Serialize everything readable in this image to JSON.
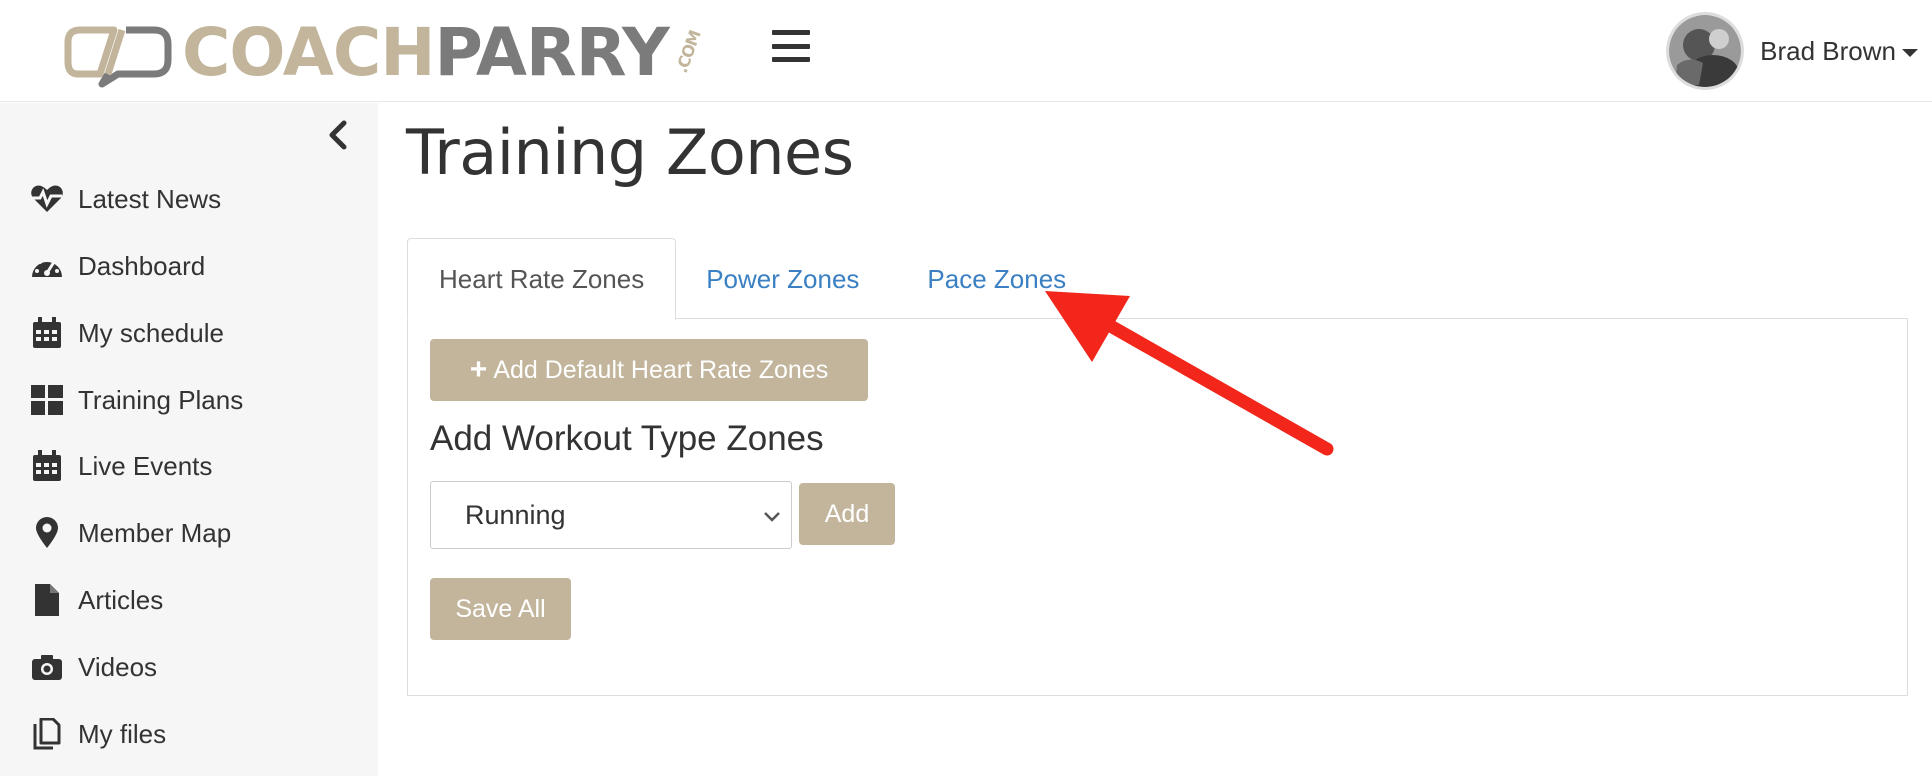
{
  "header": {
    "logo": {
      "coach": "COACH",
      "parry": "PARRY",
      "com": ".COM"
    },
    "menu_icon": "hamburger-icon",
    "user": {
      "name": "Brad Brown",
      "avatar_icon": "avatar"
    }
  },
  "sidebar": {
    "collapse_icon": "chevron-left-icon",
    "items": [
      {
        "label": "Latest News",
        "icon": "heartbeat-icon"
      },
      {
        "label": "Dashboard",
        "icon": "tachometer-icon"
      },
      {
        "label": "My schedule",
        "icon": "calendar-icon"
      },
      {
        "label": "Training Plans",
        "icon": "grid-icon"
      },
      {
        "label": "Live Events",
        "icon": "calendar-icon"
      },
      {
        "label": "Member Map",
        "icon": "map-marker-icon"
      },
      {
        "label": "Articles",
        "icon": "file-icon"
      },
      {
        "label": "Videos",
        "icon": "camera-icon"
      },
      {
        "label": "My files",
        "icon": "copy-icon"
      }
    ]
  },
  "main": {
    "title": "Training Zones",
    "tabs": [
      {
        "label": "Heart Rate Zones",
        "active": true
      },
      {
        "label": "Power Zones",
        "active": false
      },
      {
        "label": "Pace Zones",
        "active": false
      }
    ],
    "add_default_label": "Add Default Heart Rate Zones",
    "section_heading": "Add Workout Type Zones",
    "workout_select": {
      "selected": "Running"
    },
    "add_label": "Add",
    "save_all_label": "Save All"
  },
  "colors": {
    "accent": "#c2b59b",
    "link": "#3a80c2",
    "annotation_arrow": "#f2261b",
    "sidebar_bg": "#f6f6f6"
  }
}
